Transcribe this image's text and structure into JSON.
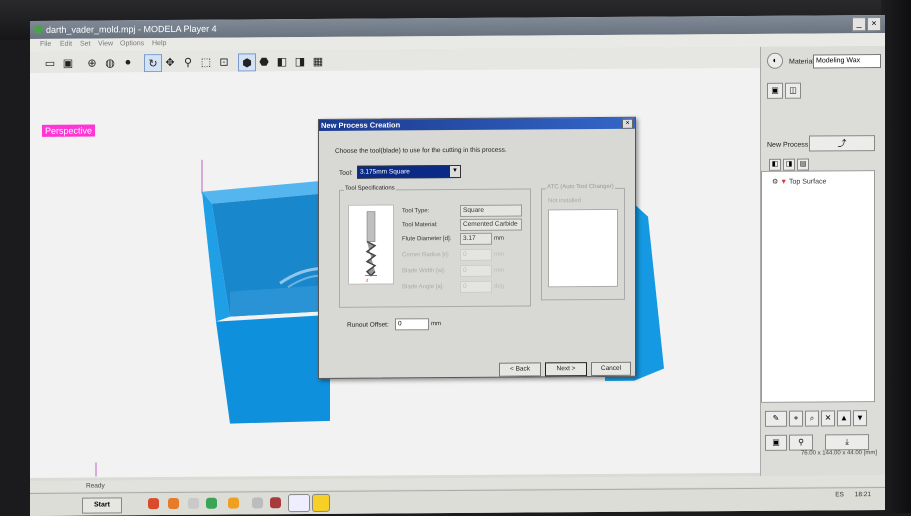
{
  "window": {
    "title": "darth_vader_mold.mpj - MODELA Player 4",
    "min_glyph": "_",
    "close_glyph": "×"
  },
  "menu": [
    "File",
    "Edit",
    "Set",
    "View",
    "Options",
    "Help"
  ],
  "viewport": {
    "view_label": "Perspective"
  },
  "right_panel": {
    "material_label": "Material",
    "material_value": "Modeling Wax",
    "new_process_label": "New Process",
    "process_item": "Top Surface",
    "dimensions": "76.00 x 144.00 x 44.00 [mm]"
  },
  "dialog": {
    "title": "New Process Creation",
    "instruction": "Choose the tool(blade) to use for the cutting in this process.",
    "tool_label": "Tool:",
    "tool_value": "3.175mm Square",
    "spec_group_label": "Tool Specifications",
    "specs": {
      "tool_type_label": "Tool Type:",
      "tool_type_value": "Square",
      "tool_material_label": "Tool Material:",
      "tool_material_value": "Cemented Carbide",
      "flute_diameter_label": "Flute Diameter [d]:",
      "flute_diameter_value": "3.17",
      "flute_diameter_unit": "mm",
      "corner_radius_label": "Corner Radius [r]:",
      "corner_radius_value": "0",
      "corner_radius_unit": "mm",
      "blade_width_label": "Blade Width [w]:",
      "blade_width_value": "0",
      "blade_width_unit": "mm",
      "blade_angle_label": "Blade Angle [a]:",
      "blade_angle_value": "0",
      "blade_angle_unit": "deg"
    },
    "atc_group_label": "ATC (Auto Tool Changer)",
    "atc_status": "Not installed",
    "runout_label": "Runout Offset:",
    "runout_value": "0",
    "runout_unit": "mm",
    "back_button": "< Back",
    "next_button": "Next >",
    "cancel_button": "Cancel"
  },
  "status": {
    "text": "Ready"
  },
  "taskbar": {
    "start_label": "Start",
    "tray_lang": "ES",
    "tray_time": "18:21"
  },
  "colors": {
    "model": "#1f9fe6",
    "perspective_tag": "#ff35d6",
    "dialog_title": "#1b3a8e"
  }
}
